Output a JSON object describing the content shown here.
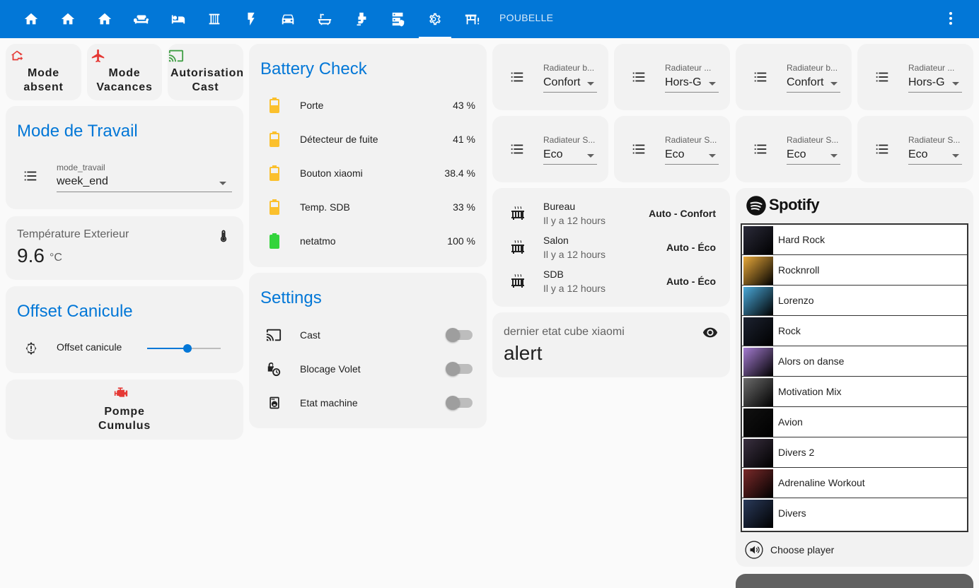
{
  "topbar": {
    "tabs": [
      {
        "icon": "home-icon"
      },
      {
        "icon": "home-icon"
      },
      {
        "icon": "home-icon"
      },
      {
        "icon": "sofa-icon"
      },
      {
        "icon": "bed-icon"
      },
      {
        "icon": "radiator-icon"
      },
      {
        "icon": "flash-icon"
      },
      {
        "icon": "car-icon"
      },
      {
        "icon": "bathtub-icon"
      },
      {
        "icon": "water-pump-icon"
      },
      {
        "icon": "server-security-icon"
      },
      {
        "icon": "gear-icon"
      },
      {
        "icon": "desk-icon"
      }
    ],
    "active_tab": "gear-icon",
    "text_tab": "POUBELLE"
  },
  "buttons": {
    "mode_absent": "Mode\nabsent",
    "mode_absent_1": "Mode",
    "mode_absent_2": "absent",
    "mode_vacances_1": "Mode",
    "mode_vacances_2": "Vacances",
    "autorisation_1": "Autorisation",
    "autorisation_2": "Cast",
    "pompe_1": "Pompe",
    "pompe_2": "Cumulus"
  },
  "mode_travail": {
    "title": "Mode de Travail",
    "label": "mode_travail",
    "value": "week_end"
  },
  "temperature": {
    "label": "Température Exterieur",
    "value": "9.6",
    "unit": "°C"
  },
  "offset": {
    "title": "Offset Canicule",
    "label": "Offset canicule",
    "slider_fraction": 0.55
  },
  "battery": {
    "title": "Battery Check",
    "items": [
      {
        "name": "Porte",
        "value": "43 %",
        "level": "mid"
      },
      {
        "name": "Détecteur de fuite",
        "value": "41 %",
        "level": "mid"
      },
      {
        "name": "Bouton xiaomi",
        "value": "38.4 %",
        "level": "mid"
      },
      {
        "name": "Temp. SDB",
        "value": "33 %",
        "level": "mid"
      },
      {
        "name": "netatmo",
        "value": "100 %",
        "level": "full"
      }
    ]
  },
  "settings": {
    "title": "Settings",
    "items": [
      {
        "name": "Cast",
        "icon": "cast-icon",
        "on": false
      },
      {
        "name": "Blocage Volet",
        "icon": "timer-lock-icon",
        "on": false
      },
      {
        "name": "Etat machine",
        "icon": "washing-machine-icon",
        "on": false
      }
    ]
  },
  "radiators": [
    {
      "label": "Radiateur b...",
      "value": "Confort"
    },
    {
      "label": "Radiateur ...",
      "value": "Hors-G"
    },
    {
      "label": "Radiateur b...",
      "value": "Confort"
    },
    {
      "label": "Radiateur ...",
      "value": "Hors-G"
    },
    {
      "label": "Radiateur S...",
      "value": "Eco"
    },
    {
      "label": "Radiateur S...",
      "value": "Eco"
    },
    {
      "label": "Radiateur S...",
      "value": "Eco"
    },
    {
      "label": "Radiateur S...",
      "value": "Eco"
    }
  ],
  "heating": [
    {
      "room": "Bureau",
      "time": "Il y a 12 hours",
      "state": "Auto - Confort"
    },
    {
      "room": "Salon",
      "time": "Il y a 12 hours",
      "state": "Auto - Éco"
    },
    {
      "room": "SDB",
      "time": "Il y a 12 hours",
      "state": "Auto - Éco"
    }
  ],
  "cube": {
    "label": "dernier etat cube xiaomi",
    "value": "alert"
  },
  "spotify": {
    "brand": "Spotify",
    "playlists": [
      {
        "name": "Hard Rock",
        "color": "#2b2b3a"
      },
      {
        "name": "Rocknroll",
        "color": "#e7a83a"
      },
      {
        "name": "Lorenzo",
        "color": "#4aa8d8"
      },
      {
        "name": "Rock",
        "color": "#1c2230"
      },
      {
        "name": "Alors on danse",
        "color": "#a47bd0"
      },
      {
        "name": "Motivation Mix",
        "color": "#6b6b6b"
      },
      {
        "name": "Avion",
        "color": "#111111"
      },
      {
        "name": "Divers 2",
        "color": "#3a3040"
      },
      {
        "name": "Adrenaline Workout",
        "color": "#7a2a2a"
      },
      {
        "name": "Divers",
        "color": "#2a3a5a"
      }
    ],
    "choose_player": "Choose player"
  },
  "colors": {
    "accent": "#0277d7",
    "battery_mid": "#fbc02d",
    "battery_full": "#33d43c",
    "red_icon": "#e53935",
    "green_icon": "#43a047"
  }
}
